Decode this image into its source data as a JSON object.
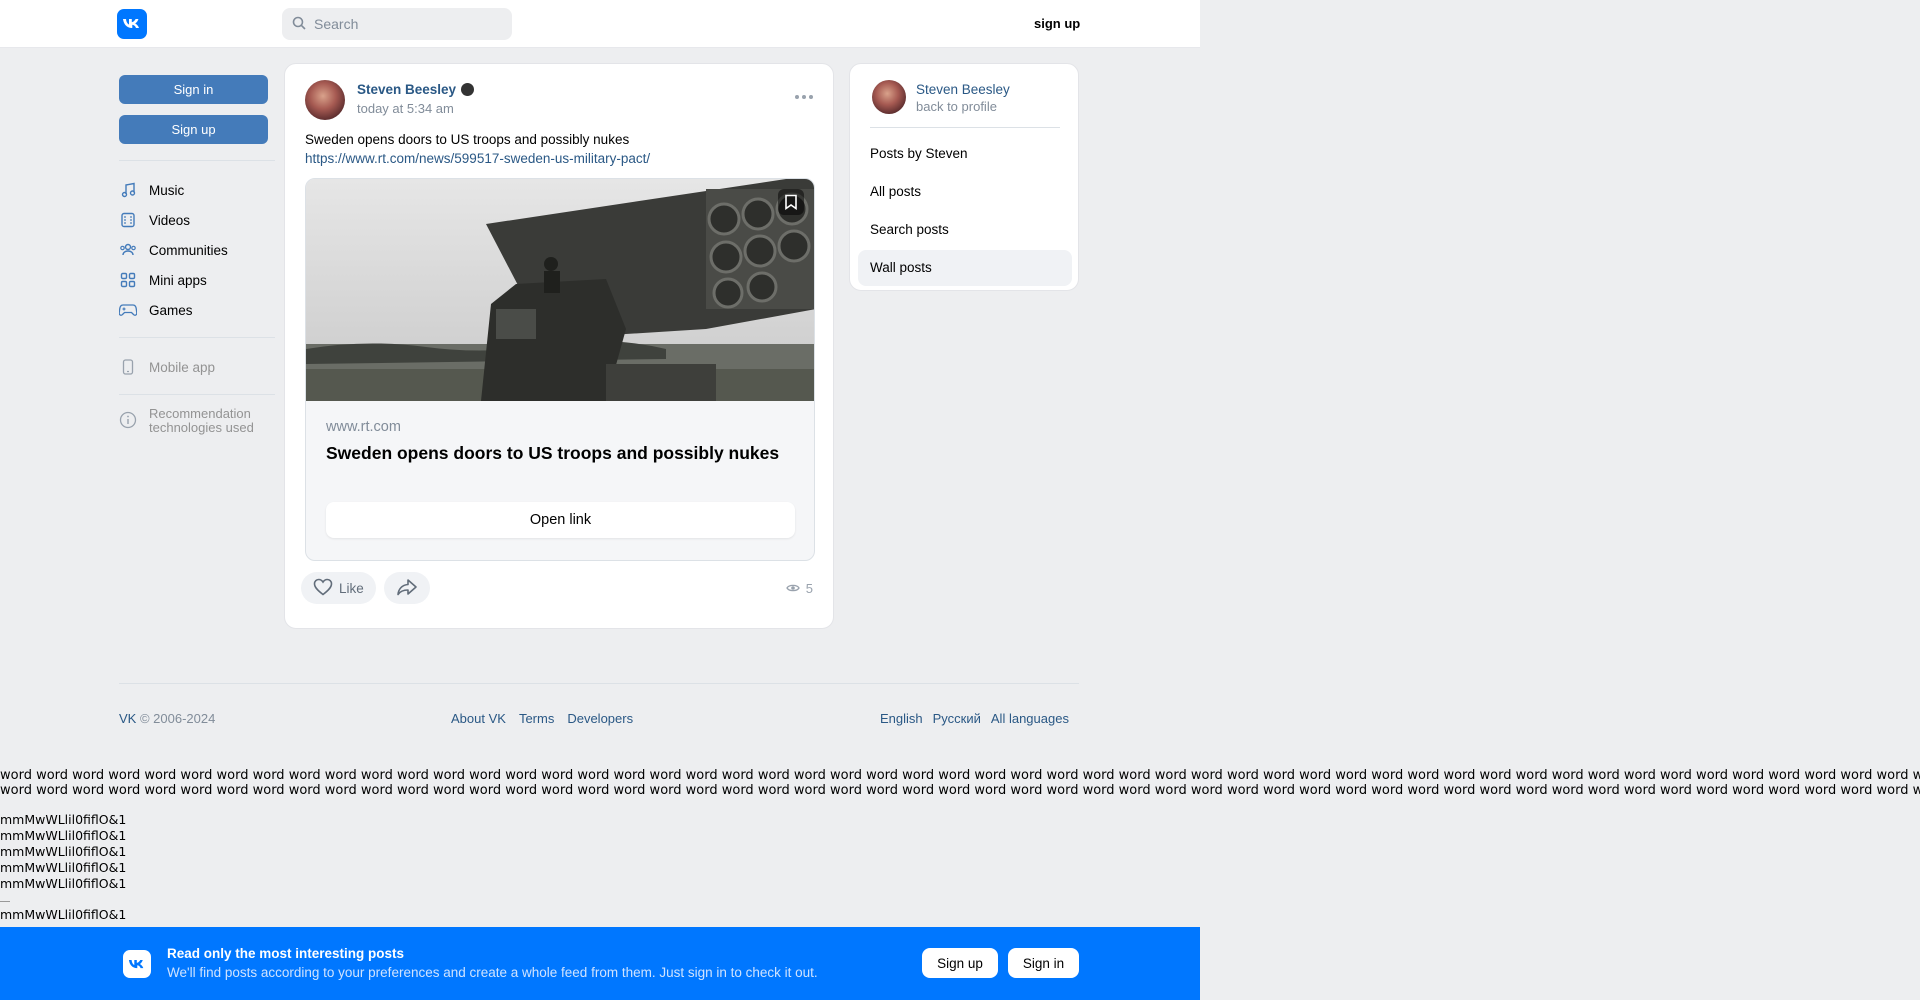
{
  "header": {
    "search_placeholder": "Search",
    "signup_label": "sign up"
  },
  "sidebar": {
    "signin_label": "Sign in",
    "signup_label": "Sign up",
    "nav": [
      {
        "label": "Music",
        "icon": "music-icon"
      },
      {
        "label": "Videos",
        "icon": "videos-icon"
      },
      {
        "label": "Communities",
        "icon": "communities-icon"
      },
      {
        "label": "Mini apps",
        "icon": "mini-apps-icon"
      },
      {
        "label": "Games",
        "icon": "games-icon"
      }
    ],
    "mobile_app": "Mobile app",
    "recommendation": "Recommendation technologies used"
  },
  "post": {
    "author": "Steven Beesley",
    "date": "today at 5:34 am",
    "text": "Sweden opens doors to US troops and possibly nukes",
    "link": "https://www.rt.com/news/599517-sweden-us-military-pact/",
    "snippet": {
      "domain": "www.rt.com",
      "title": "Sweden opens doors to US troops and possibly nukes",
      "open_label": "Open link"
    },
    "like_label": "Like",
    "views": "5"
  },
  "right_panel": {
    "name": "Steven Beesley",
    "back": "back to profile",
    "items": [
      "Posts by Steven",
      "All posts",
      "Search posts",
      "Wall posts"
    ],
    "active_item": "Wall posts"
  },
  "footer": {
    "brand": "VK",
    "copyright": " © 2006-2024",
    "links_mid": [
      "About VK",
      "Terms",
      "Developers"
    ],
    "links_right": [
      "English",
      "Русский",
      "All languages"
    ]
  },
  "test_text": {
    "word_line": "word word word word word word word word word word word word word word word word word word word word word word word word word word word word word word word word word word word word word word word word word word word word word word word word word word word word word word word word word word word word word word word word word word word word word word word word word word word word word",
    "mm_line": "mmMwWLlil0fiflO&1"
  },
  "banner": {
    "title": "Read only the most interesting posts",
    "subtitle": "We'll find posts according to your preferences and create a whole feed from them. Just sign in to check it out.",
    "signup_label": "Sign up",
    "signin_label": "Sign in"
  },
  "colors": {
    "brand": "#0077ff",
    "button": "#447bba",
    "link": "#2a5885",
    "background": "#edeef0"
  }
}
